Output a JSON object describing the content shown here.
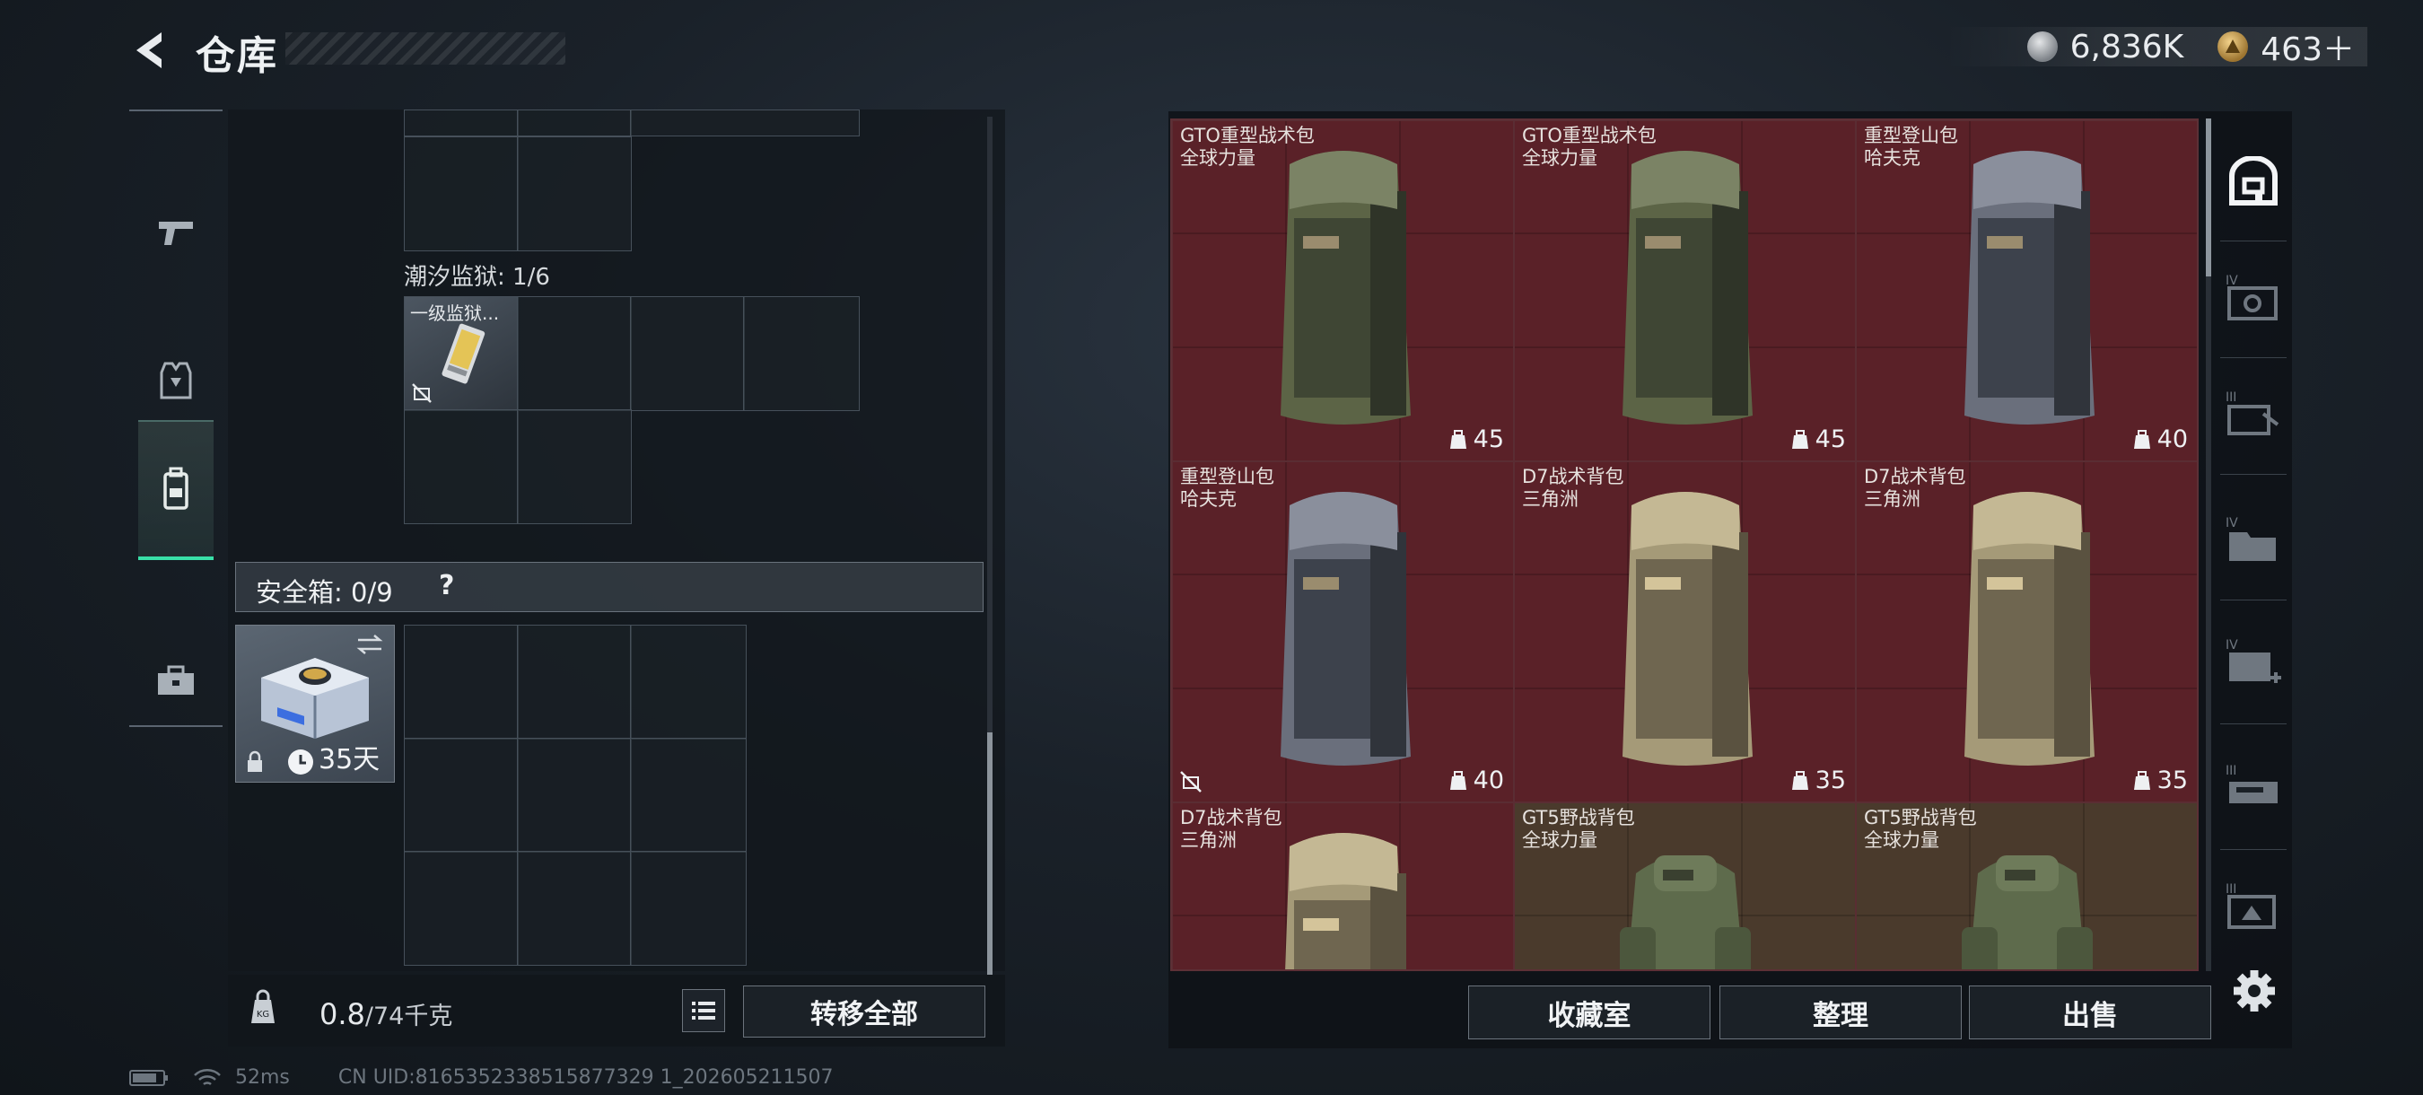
{
  "header": {
    "title": "仓库",
    "currency": [
      {
        "icon": "silver-coin-icon",
        "value": "6,836K"
      },
      {
        "icon": "gold-triangle-coin-icon",
        "value": "463＋"
      }
    ]
  },
  "left_nav": [
    {
      "name": "weapons",
      "icon": "pistol-icon"
    },
    {
      "name": "armor",
      "icon": "vest-icon"
    },
    {
      "name": "backpack",
      "icon": "backpack-icon",
      "active": true
    },
    {
      "name": "toolbox",
      "icon": "toolbox-icon"
    }
  ],
  "containers": {
    "prison_label": "潮汐监狱: 1/6",
    "prison_item_label": "一级监狱...",
    "safe_box_label": "安全箱: 0/9",
    "safe_box_help": "?",
    "safe_box_timer": "35天"
  },
  "bottom_left": {
    "weight_current": "0.8",
    "weight_max": "/74千克",
    "transfer_all": "转移全部"
  },
  "items": [
    {
      "name": "GTO重型战术包",
      "brand": "全球力量",
      "capacity": "45",
      "color": "red",
      "bag": "olive-tall"
    },
    {
      "name": "GTO重型战术包",
      "brand": "全球力量",
      "capacity": "45",
      "color": "red",
      "bag": "olive-tall"
    },
    {
      "name": "重型登山包",
      "brand": "哈夫克",
      "capacity": "40",
      "color": "red",
      "bag": "gray-tall"
    },
    {
      "name": "重型登山包",
      "brand": "哈夫克",
      "capacity": "40",
      "color": "red",
      "bag": "gray-tall",
      "untradeable": true
    },
    {
      "name": "D7战术背包",
      "brand": "三角洲",
      "capacity": "35",
      "color": "red",
      "bag": "tan-tall"
    },
    {
      "name": "D7战术背包",
      "brand": "三角洲",
      "capacity": "35",
      "color": "red",
      "bag": "tan-tall"
    },
    {
      "name": "D7战术背包",
      "brand": "三角洲",
      "capacity": "",
      "color": "red",
      "bag": "tan-tall"
    },
    {
      "name": "GT5野战背包",
      "brand": "全球力量",
      "capacity": "",
      "color": "olive",
      "bag": "green-round"
    },
    {
      "name": "GT5野战背包",
      "brand": "全球力量",
      "capacity": "",
      "color": "olive",
      "bag": "green-round"
    }
  ],
  "right_categories": [
    {
      "icon": "all-categories-icon",
      "tier": ""
    },
    {
      "icon": "tier-iv-case-icon",
      "tier": "IV"
    },
    {
      "icon": "tier-iii-case-icon",
      "tier": "III"
    },
    {
      "icon": "tier-iv-folder-icon",
      "tier": "IV"
    },
    {
      "icon": "tier-iv-medkit-icon",
      "tier": "IV"
    },
    {
      "icon": "tier-iii-rifle-case-icon",
      "tier": "III"
    },
    {
      "icon": "tier-iii-box-icon",
      "tier": "III"
    }
  ],
  "bottom_right": {
    "collection": "收藏室",
    "organize": "整理",
    "sell": "出售"
  },
  "footer": {
    "ping": "52ms",
    "uid": "CN UID:8165352338515877329 1_202605211507"
  },
  "colors": {
    "accent_green": "#39e0a8",
    "item_red_bg": "#5a2128",
    "item_olive_bg": "#4a3a2c"
  }
}
